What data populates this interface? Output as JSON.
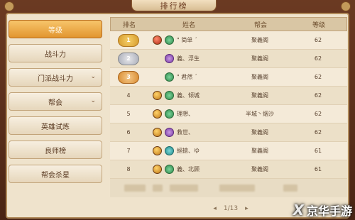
{
  "window": {
    "title": "排行榜"
  },
  "sidebar": {
    "items": [
      {
        "label": "等级",
        "active": true,
        "has_chevron": false
      },
      {
        "label": "战斗力",
        "active": false,
        "has_chevron": false
      },
      {
        "label": "门派战斗力",
        "active": false,
        "has_chevron": true
      },
      {
        "label": "帮会",
        "active": false,
        "has_chevron": true
      },
      {
        "label": "英雄试炼",
        "active": false,
        "has_chevron": false
      },
      {
        "label": "良师榜",
        "active": false,
        "has_chevron": false
      },
      {
        "label": "帮会杀星",
        "active": false,
        "has_chevron": false
      }
    ],
    "chevron_glyph": "⌄"
  },
  "table": {
    "headers": {
      "rank": "排名",
      "name": "姓名",
      "guild": "帮会",
      "level": "等级"
    },
    "rows": [
      {
        "rank": "1",
        "medal": "gold",
        "avatar": "red",
        "emblem": "green",
        "name": "\" 简单 ´",
        "guild": "聚義阁",
        "level": "62"
      },
      {
        "rank": "2",
        "medal": "silver",
        "avatar": "empty",
        "emblem": "purple",
        "name": "義、浮生",
        "guild": "聚義阁",
        "level": "62"
      },
      {
        "rank": "3",
        "medal": "bronze",
        "avatar": "empty",
        "emblem": "green",
        "name": "\" 君然 ´",
        "guild": "聚義阁",
        "level": "62"
      },
      {
        "rank": "4",
        "medal": "",
        "avatar": "gold",
        "emblem": "green",
        "name": "義、倾城",
        "guild": "聚義阁",
        "level": "62"
      },
      {
        "rank": "5",
        "medal": "",
        "avatar": "gold",
        "emblem": "green",
        "name": "理想、",
        "guild": "半城丶烟沙",
        "level": "62"
      },
      {
        "rank": "6",
        "medal": "",
        "avatar": "gold",
        "emblem": "purple",
        "name": "救世、",
        "guild": "聚義阁",
        "level": "62"
      },
      {
        "rank": "7",
        "medal": "",
        "avatar": "gold",
        "emblem": "teal",
        "name": "絕搶、ゆ",
        "guild": "聚義阁",
        "level": "61"
      },
      {
        "rank": "8",
        "medal": "",
        "avatar": "gold",
        "emblem": "green",
        "name": "義、北顾",
        "guild": "聚義阁",
        "level": "61"
      }
    ]
  },
  "pager": {
    "prev": "◂",
    "page": "1/13",
    "next": "▸"
  },
  "watermark": {
    "mark": "X",
    "text": "京华手游"
  },
  "colors": {
    "accent": "#e2952f",
    "panel": "#efe3cc",
    "frame": "#4a2414"
  }
}
